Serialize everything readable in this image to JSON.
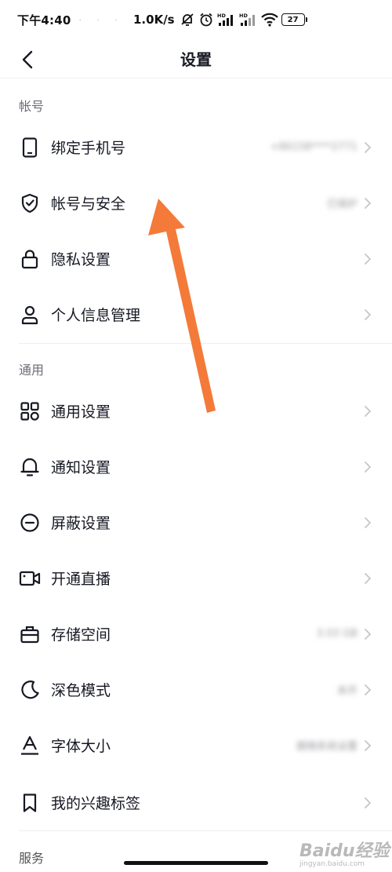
{
  "status_bar": {
    "time": "下午4:40",
    "dots": "· · ·",
    "net_speed": "1.0K/s",
    "battery": "27",
    "icons": [
      "mute-alarm-icon",
      "alarm-icon",
      "hd-signal-icon",
      "hd-signal-icon",
      "wifi-icon",
      "battery-icon"
    ]
  },
  "nav": {
    "title": "设置",
    "back_icon": "chevron-left-icon"
  },
  "sections": {
    "account": {
      "title": "帐号",
      "items": [
        {
          "label": "绑定手机号",
          "value": "+86158****2771",
          "icon": "phone-icon"
        },
        {
          "label": "帐号与安全",
          "value": "已保护",
          "icon": "shield-check-icon"
        },
        {
          "label": "隐私设置",
          "value": "",
          "icon": "lock-icon"
        },
        {
          "label": "个人信息管理",
          "value": "",
          "icon": "person-icon"
        }
      ]
    },
    "general": {
      "title": "通用",
      "items": [
        {
          "label": "通用设置",
          "value": "",
          "icon": "grid-icon"
        },
        {
          "label": "通知设置",
          "value": "",
          "icon": "bell-icon"
        },
        {
          "label": "屏蔽设置",
          "value": "",
          "icon": "block-icon"
        },
        {
          "label": "开通直播",
          "value": "",
          "icon": "video-camera-icon"
        },
        {
          "label": "存储空间",
          "value": "3.03 GB",
          "icon": "briefcase-icon"
        },
        {
          "label": "深色模式",
          "value": "未开",
          "icon": "moon-icon"
        },
        {
          "label": "字体大小",
          "value": "跟随系统设置",
          "icon": "font-size-icon"
        },
        {
          "label": "我的兴趣标签",
          "value": "",
          "icon": "bookmark-icon"
        }
      ]
    },
    "service": {
      "title": "服务"
    }
  },
  "watermark": {
    "main": "Baidu经验",
    "sub": "jingyan.baidu.com"
  },
  "colors": {
    "text": "#161823",
    "muted": "#6b6d75",
    "arrow": "#f47a3a"
  }
}
